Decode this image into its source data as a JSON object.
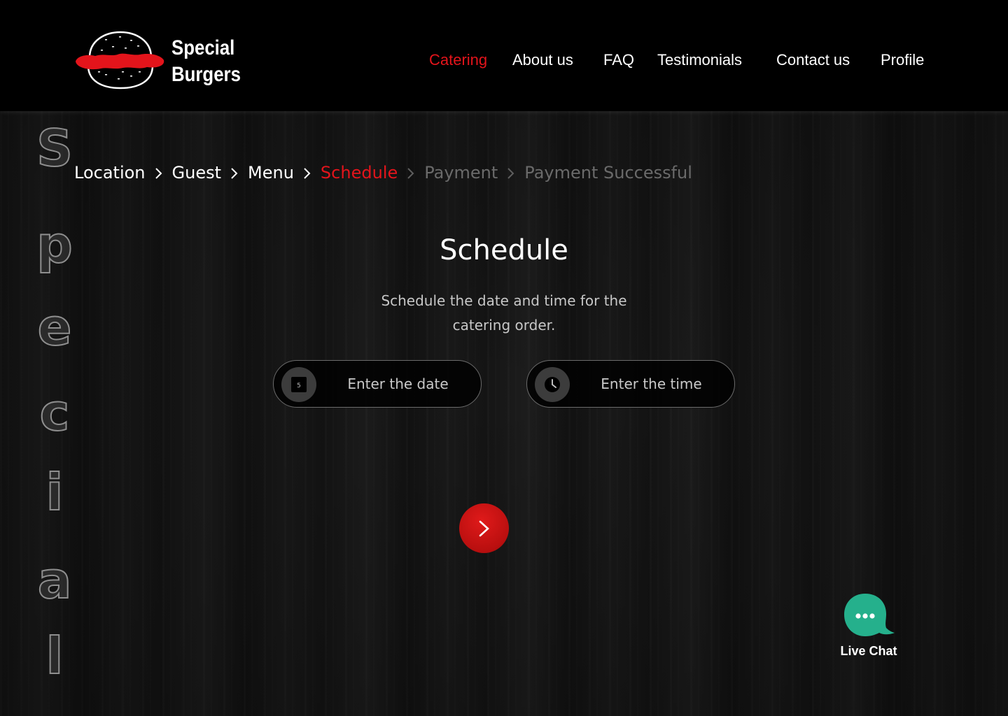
{
  "brand": {
    "name_line1": "Special",
    "name_line2": "Burgers",
    "logo_icon": "burger-logo-icon",
    "accent_color": "#e3141b"
  },
  "nav": {
    "items": [
      {
        "label": "Catering",
        "active": true
      },
      {
        "label": "About us",
        "active": false
      },
      {
        "label": "FAQ",
        "active": false
      },
      {
        "label": "Testimonials",
        "active": false
      },
      {
        "label": "Contact us",
        "active": false
      },
      {
        "label": "Profile",
        "active": false
      }
    ]
  },
  "side_watermark": {
    "letters": [
      "S",
      "p",
      "e",
      "c",
      "i",
      "a",
      "l"
    ]
  },
  "breadcrumb": {
    "steps": [
      {
        "label": "Location",
        "state": "done"
      },
      {
        "label": "Guest",
        "state": "done"
      },
      {
        "label": "Menu",
        "state": "done"
      },
      {
        "label": "Schedule",
        "state": "current"
      },
      {
        "label": "Payment",
        "state": "upcoming"
      },
      {
        "label": "Payment Successful",
        "state": "upcoming"
      }
    ],
    "separator_icon": "chevron-right-icon"
  },
  "main": {
    "title": "Schedule",
    "subtitle_line1": "Schedule the date and time for the",
    "subtitle_line2": "catering order.",
    "date_field": {
      "placeholder": "Enter the date",
      "value": "",
      "icon": "calendar-icon",
      "icon_text": "5"
    },
    "time_field": {
      "placeholder": "Enter the time",
      "value": "",
      "icon": "clock-icon"
    },
    "next_button": {
      "icon": "chevron-right-icon",
      "color": "#c8111a"
    }
  },
  "live_chat": {
    "label": "Live Chat",
    "icon": "chat-bubble-icon",
    "color": "#25b08c"
  }
}
